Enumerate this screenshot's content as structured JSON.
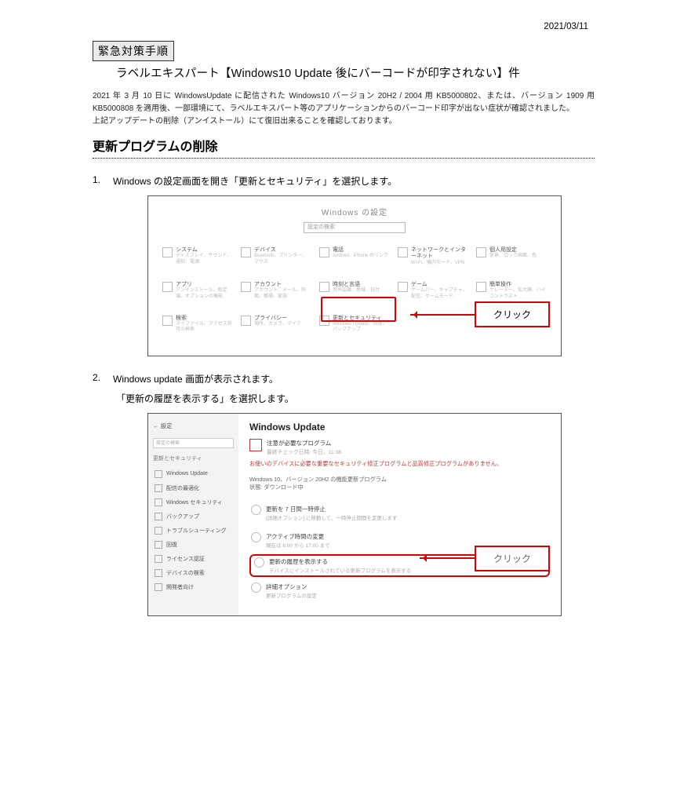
{
  "date": "2021/03/11",
  "badge": "緊急対策手順",
  "subtitle": "ラベルエキスパート【Windows10 Update 後にバーコードが印字されない】件",
  "intro_line1": "2021 年 3 月 10 日に WindowsUpdate に配信された Windows10 バージョン 20H2 / 2004 用 KB5000802、または、バージョン 1909 用 KB5000808 を適用後、一部環境にて、ラベルエキスパート等のアプリケーションからのバーコード印字が出ない症状が確認されました。",
  "intro_line2": "上記アップデートの削除（アンイストール）にて復旧出来ることを確認しております。",
  "section_heading": "更新プログラムの削除",
  "steps": {
    "s1_num": "1.",
    "s1_text": "Windows の設定画面を開き「更新とセキュリティ」を選択します。",
    "s2_num": "2.",
    "s2_text": "Windows update 画面が表示されます。",
    "s2_sub": "「更新の履歴を表示する」を選択します。"
  },
  "callout_click": "クリック",
  "settings": {
    "title": "Windows の設定",
    "search_placeholder": "設定の検索",
    "tiles": [
      {
        "l1": "システム",
        "l2": "ディスプレイ、サウンド、通知、電源"
      },
      {
        "l1": "デバイス",
        "l2": "Bluetooth、プリンター、マウス"
      },
      {
        "l1": "電話",
        "l2": "Android、iPhone のリンク"
      },
      {
        "l1": "ネットワークとインターネット",
        "l2": "Wi-Fi、機内モード、VPN"
      },
      {
        "l1": "個人用設定",
        "l2": "背景、ロック画面、色"
      },
      {
        "l1": "アプリ",
        "l2": "アンインストール、既定値、オプションの機能"
      },
      {
        "l1": "アカウント",
        "l2": "アカウント、メール、同期、職場、家族"
      },
      {
        "l1": "時刻と言語",
        "l2": "音声認識、地域、日付"
      },
      {
        "l1": "ゲーム",
        "l2": "ゲームバー、キャプチャ、配信、ゲームモード"
      },
      {
        "l1": "簡単操作",
        "l2": "ナレーター、拡大鏡、ハイコントラスト"
      },
      {
        "l1": "検索",
        "l2": "マイファイル、アクセス許可の検索"
      },
      {
        "l1": "プライバシー",
        "l2": "場所、カメラ、マイク"
      },
      {
        "l1": "更新とセキュリティ",
        "l2": "Windows Update、回復、バックアップ"
      }
    ]
  },
  "wu": {
    "back": "← 設定",
    "search": "設定の検索",
    "section_label": "更新とセキュリティ",
    "sidebar_items": [
      "Windows Update",
      "配信の最適化",
      "Windows セキュリティ",
      "バックアップ",
      "トラブルシューティング",
      "回復",
      "ライセンス認証",
      "デバイスの検索",
      "開発者向け"
    ],
    "page_title": "Windows Update",
    "attention_l1": "注意が必要なプログラム",
    "attention_l2": "最終チェック日時: 今日、11:38",
    "red_info": "お使いのデバイスに必要な重要なセキュリティ修正プログラムと品質修正プログラムがありません。",
    "sub_info1": "Windows 10、バージョン 20H2 の機能更新プログラム",
    "sub_info2": "状態: ダウンロード中",
    "opts": [
      {
        "l1": "更新を 7 日間一時停止",
        "l2": "[詳細オプション] に移動して、一時停止期間を変更します"
      },
      {
        "l1": "アクティブ時間の変更",
        "l2": "現在は 8:00 から 17:00 まで"
      },
      {
        "l1": "更新の履歴を表示する",
        "l2": "デバイスにインストールされている更新プログラムを表示する"
      },
      {
        "l1": "詳細オプション",
        "l2": "更新プログラムの設定"
      }
    ]
  }
}
